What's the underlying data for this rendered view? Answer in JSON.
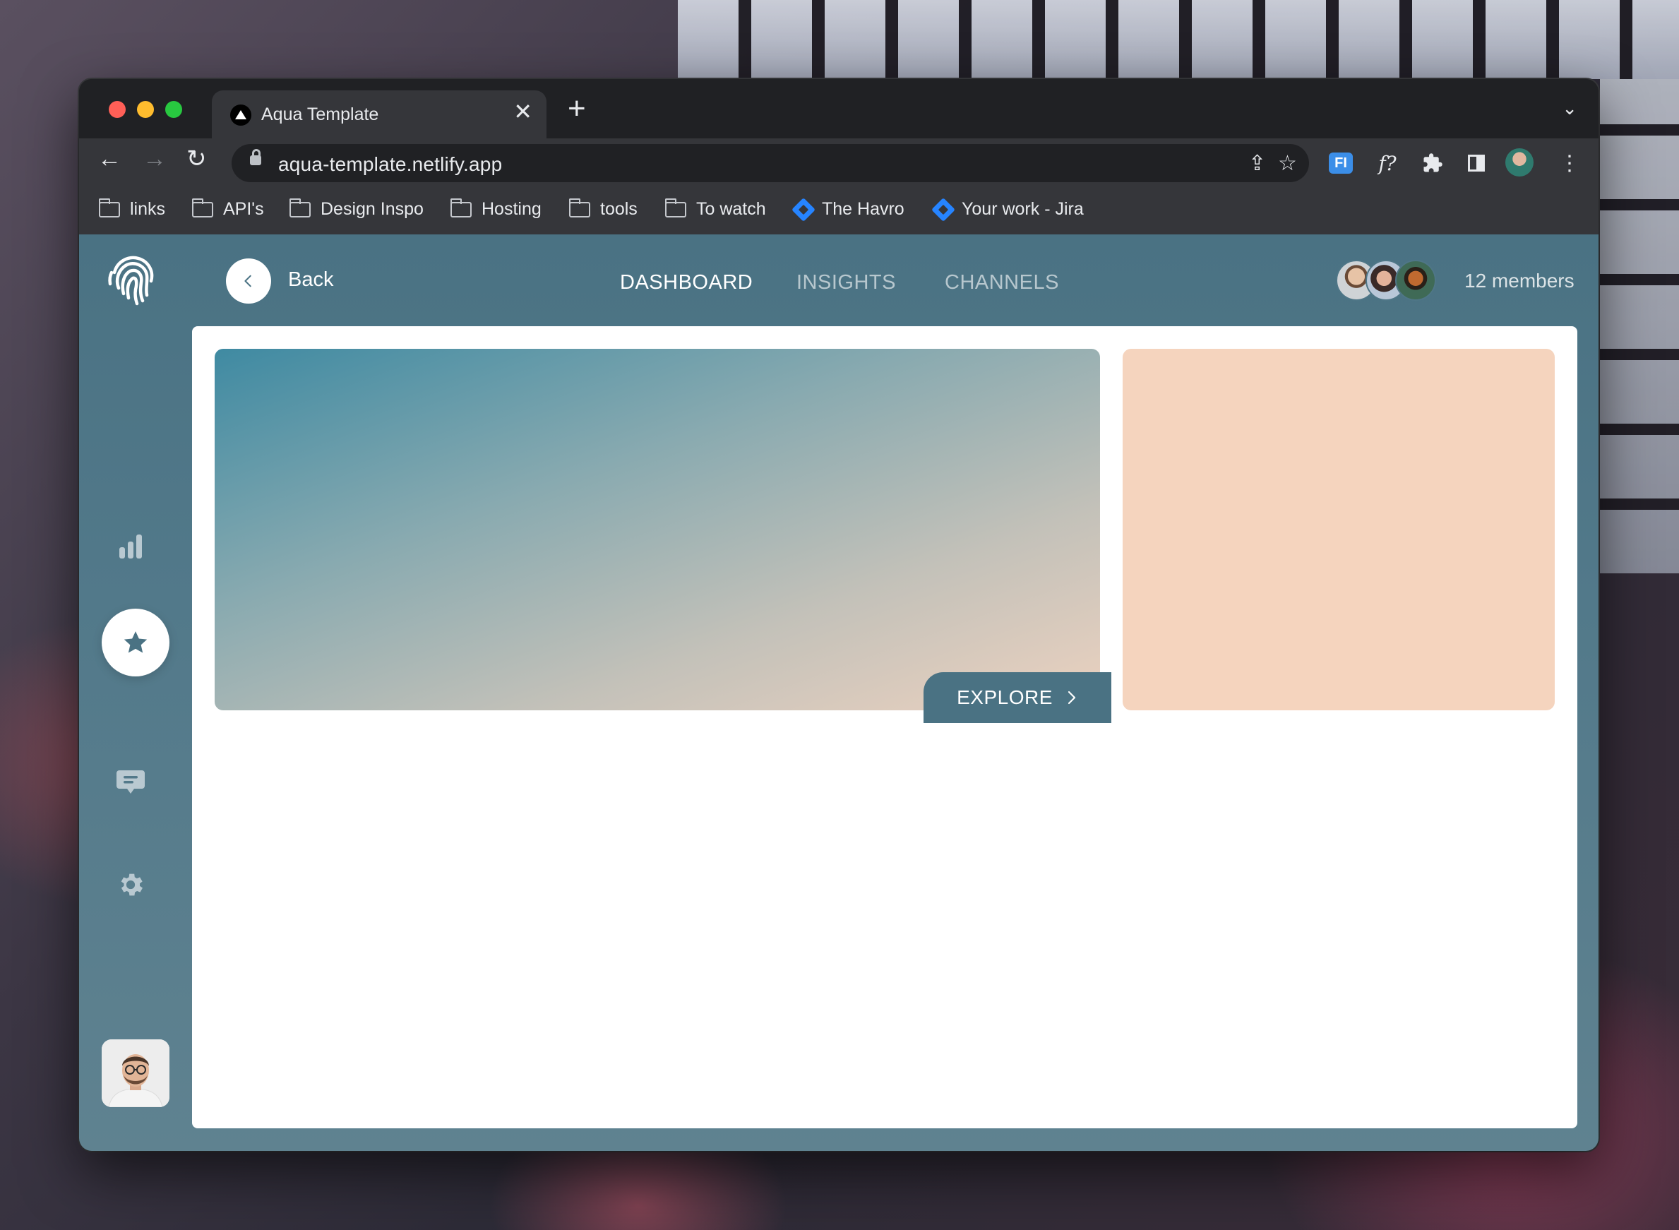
{
  "browser": {
    "tab_title": "Aqua Template",
    "url": "aqua-template.netlify.app",
    "bookmarks": [
      {
        "label": "links",
        "icon": "folder-icon"
      },
      {
        "label": "API's",
        "icon": "folder-icon"
      },
      {
        "label": "Design Inspo",
        "icon": "folder-icon"
      },
      {
        "label": "Hosting",
        "icon": "folder-icon"
      },
      {
        "label": "tools",
        "icon": "folder-icon"
      },
      {
        "label": "To watch",
        "icon": "folder-icon"
      },
      {
        "label": "The Havro",
        "icon": "jira-icon"
      },
      {
        "label": "Your work - Jira",
        "icon": "jira-icon"
      }
    ],
    "extension_fi_label": "FI",
    "extension_f_label": "f?"
  },
  "app": {
    "back_label": "Back",
    "nav": {
      "dashboard": "DASHBOARD",
      "insights": "INSIGHTS",
      "channels": "CHANNELS",
      "active": "DASHBOARD"
    },
    "members_label": "12 members",
    "explore_label": "EXPLORE",
    "sidebar_icons": [
      "fingerprint-icon",
      "bar-chart-icon",
      "star-icon",
      "chat-icon",
      "gear-icon"
    ],
    "colors": {
      "accent": "#4a7283",
      "peach_card": "#f5d4be",
      "hero_start": "#3f8aa2",
      "hero_end": "#ecd2c0"
    }
  }
}
